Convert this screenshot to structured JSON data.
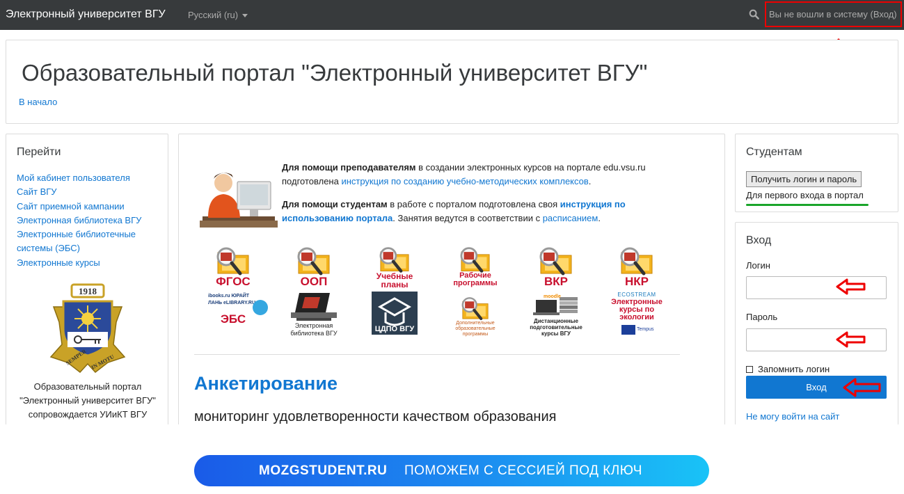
{
  "topbar": {
    "brand": "Электронный университет ВГУ",
    "language": "Русский (ru)",
    "login_status": "Вы не вошли в систему (Вход)"
  },
  "header": {
    "title": "Образовательный портал \"Электронный университет ВГУ\"",
    "breadcrumb": "В начало"
  },
  "left_block": {
    "title": "Перейти",
    "links": [
      "Мой кабинет пользователя",
      "Сайт ВГУ",
      "Сайт приемной кампании",
      "Электронная библиотека ВГУ",
      "Электронные библиотечные системы (ЭБС)",
      "Электронные курсы"
    ],
    "crest_year": "1918",
    "crest_motto": "SEMPER IN MOTU",
    "portal_note": [
      "Образовательный портал",
      "\"Электронный университет ВГУ\"",
      "сопровождается УИиКТ ВГУ"
    ]
  },
  "main": {
    "teachers_bold": "Для помощи преподавателям",
    "teachers_text": " в создании электронных курсов на портале edu.vsu.ru подготовлена ",
    "teachers_link": "инструкция по созданию учебно-методических комплексов",
    "teachers_end": ".",
    "students_bold": "Для помощи студентам",
    "students_text": " в работе с порталом подготовлена своя ",
    "students_link": "инструкция по использованию портала",
    "students_mid": ". Занятия ведутся в соответствии с ",
    "schedule_link": "расписанием",
    "students_end": ".",
    "tiles_row1": [
      "ФГОС",
      "ООП",
      "Учебные планы",
      "Рабочие программы",
      "ВКР",
      "НКР"
    ],
    "tiles_row2": [
      {
        "top": "ibooks.ru  ЮРАЙТ  ЛАНЬ  eLIBRARY.RU",
        "label": "ЭБС"
      },
      {
        "top": "",
        "label": "Электронная библиотека ВГУ"
      },
      {
        "top": "",
        "label": "ЦДПО ВГУ"
      },
      {
        "top": "",
        "label": "Дополнительные образовательные программы"
      },
      {
        "top": "moodle",
        "label": "Дистанционные подготовительные курсы ВГУ"
      },
      {
        "top": "ECOSTREAM",
        "label": "Электронные курсы по экологии",
        "sub": "Tempus"
      }
    ],
    "survey_title": "Анкетирование",
    "survey_subtitle": "мониторинг удовлетворенности качеством образования"
  },
  "students_block": {
    "title": "Студентам",
    "button": "Получить логин и пароль",
    "note": "Для первого входа в портал"
  },
  "login_block": {
    "title": "Вход",
    "login_label": "Логин",
    "password_label": "Пароль",
    "remember": "Запомнить логин",
    "submit": "Вход",
    "forgot": "Не могу войти на сайт"
  },
  "banner": {
    "brand": "MOZGSTUDENT.RU",
    "tagline": "ПОМОЖЕМ С СЕССИЕЙ ПОД КЛЮЧ"
  },
  "colors": {
    "navbar": "#373a3c",
    "link": "#1177d1",
    "accent_red": "#e00000",
    "green_underline": "#1aa52a"
  }
}
